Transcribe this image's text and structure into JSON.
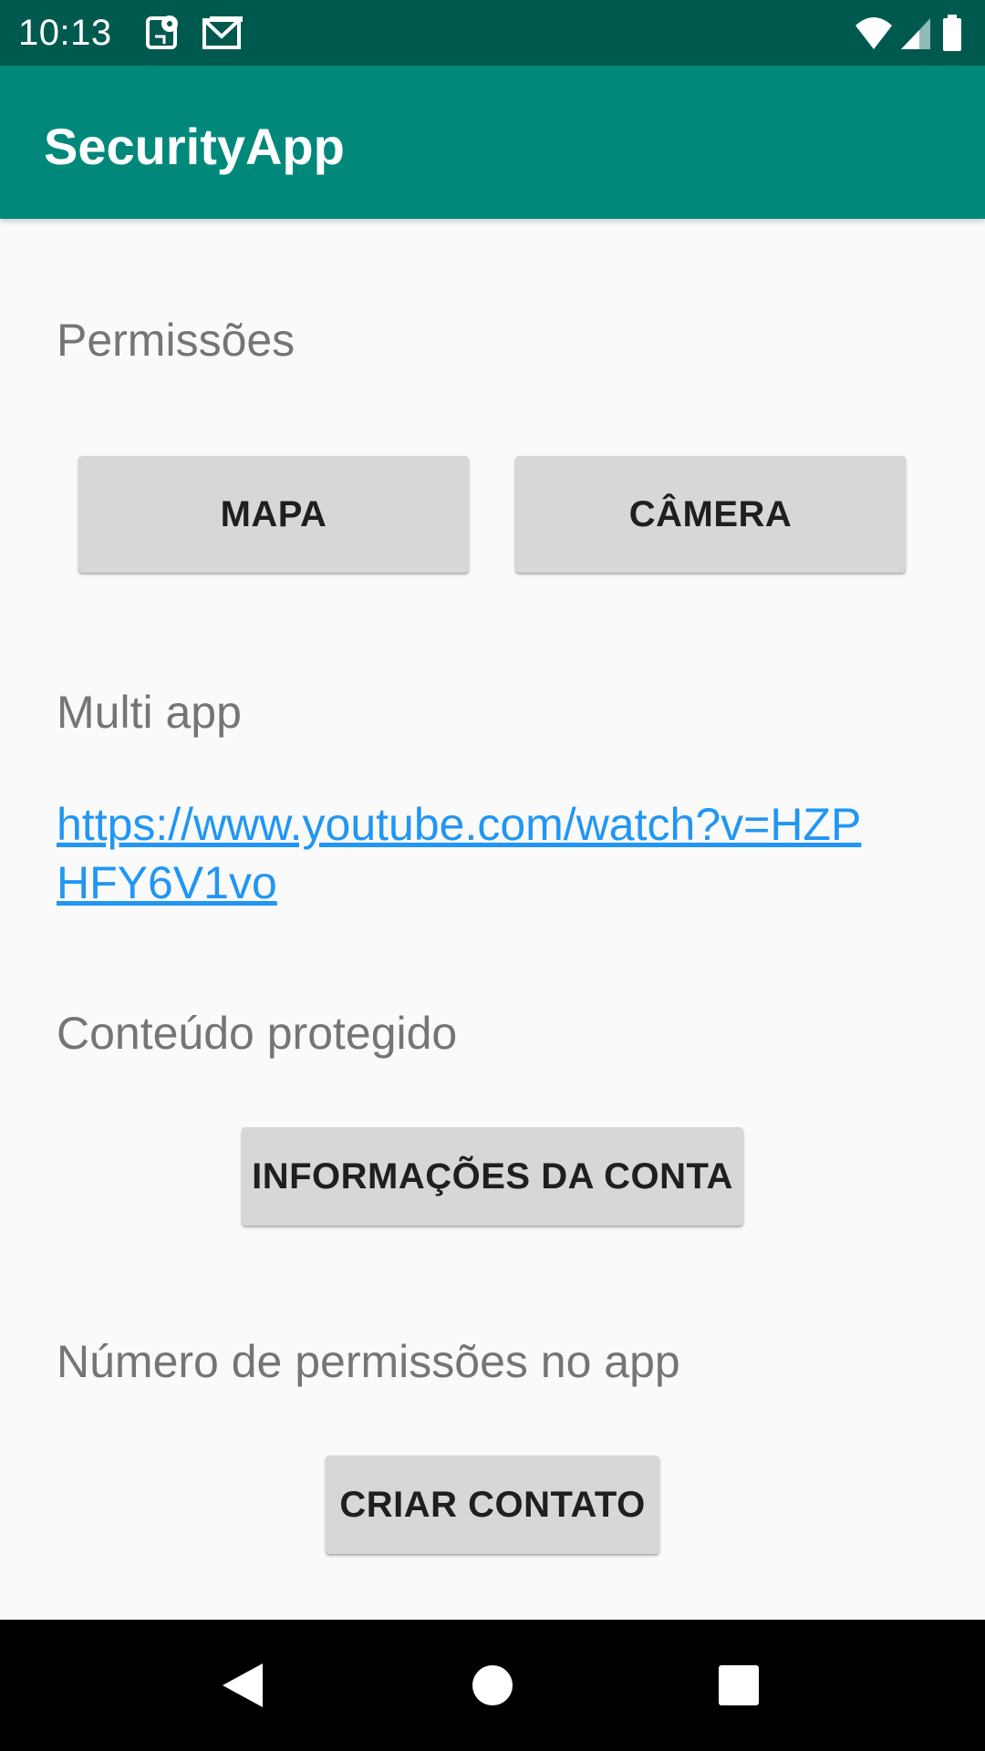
{
  "status_bar": {
    "time": "10:13",
    "left_icons": [
      "maps-notification-icon",
      "gmail-notification-icon"
    ],
    "right_icons": [
      "wifi-icon",
      "cell-signal-icon",
      "battery-icon"
    ]
  },
  "app_bar": {
    "title": "SecurityApp"
  },
  "sections": {
    "permissions": {
      "label": "Permissões",
      "map_button": "MAPA",
      "camera_button": "CÂMERA"
    },
    "multi_app": {
      "label": "Multi app",
      "link": "https://www.youtube.com/watch?v=HZPHFY6V1vo"
    },
    "protected_content": {
      "label": "Conteúdo protegido",
      "account_button": "INFORMAÇÕES DA CONTA"
    },
    "permission_count": {
      "label": "Número de permissões no app",
      "contact_button": "CRIAR CONTATO"
    }
  },
  "nav_bar": {
    "buttons": [
      "back-icon",
      "home-icon",
      "recents-icon"
    ]
  },
  "colors": {
    "status_bar": "#00594f",
    "app_bar": "#00897b",
    "link": "#2196f3",
    "button": "#d6d7d7",
    "background": "#fafafa"
  }
}
